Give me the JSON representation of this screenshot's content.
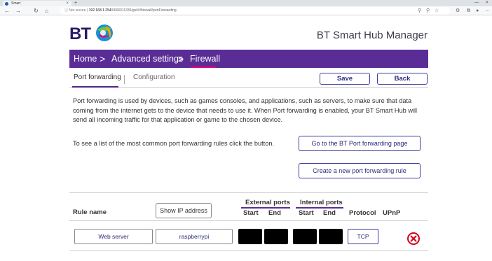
{
  "browser": {
    "tab_title": "Smart",
    "url_prefix": "Not secure",
    "url_host": "192.168.1.254",
    "url_path": "/0606011336/gui/#/firewall/portForwarding",
    "new_tab_glyph": "+",
    "minimize_glyph": "—",
    "close_glyph": "×"
  },
  "header": {
    "logo_text": "BT",
    "app_title": "BT Smart Hub Manager"
  },
  "breadcrumb": {
    "home": "Home",
    "advanced": "Advanced settings",
    "firewall": "Firewall",
    "separator": ">"
  },
  "subtabs": {
    "port_forwarding": "Port forwarding",
    "configuration": "Configuration"
  },
  "actions": {
    "save": "Save",
    "back": "Back"
  },
  "intro_text": "Port forwarding is used by devices, such as games consoles, and applications, such as servers, to make sure that data coming from the internet gets to the device that needs to use it. When Port forwarding is enabled, your BT Smart Hub will send all incoming traffic for that application or game to the chosen device.",
  "list_text": "To see a list of the most common port forwarding rules click the button.",
  "buttons": {
    "bt_page": "Go to the BT Port forwarding page",
    "new_rule": "Create a new port forwarding rule",
    "show_ip": "Show IP address"
  },
  "table": {
    "rule_name": "Rule name",
    "external_ports": "External ports",
    "internal_ports": "Internal ports",
    "start": "Start",
    "end": "End",
    "protocol": "Protocol",
    "upnp": "UPnP"
  },
  "rows": [
    {
      "rule_name": "Web server",
      "device": "raspberrypi",
      "protocol": "TCP"
    }
  ],
  "colors": {
    "brand_purple": "#5a2d96",
    "accent_pink": "#e4007c",
    "delete_red": "#d0021b"
  }
}
